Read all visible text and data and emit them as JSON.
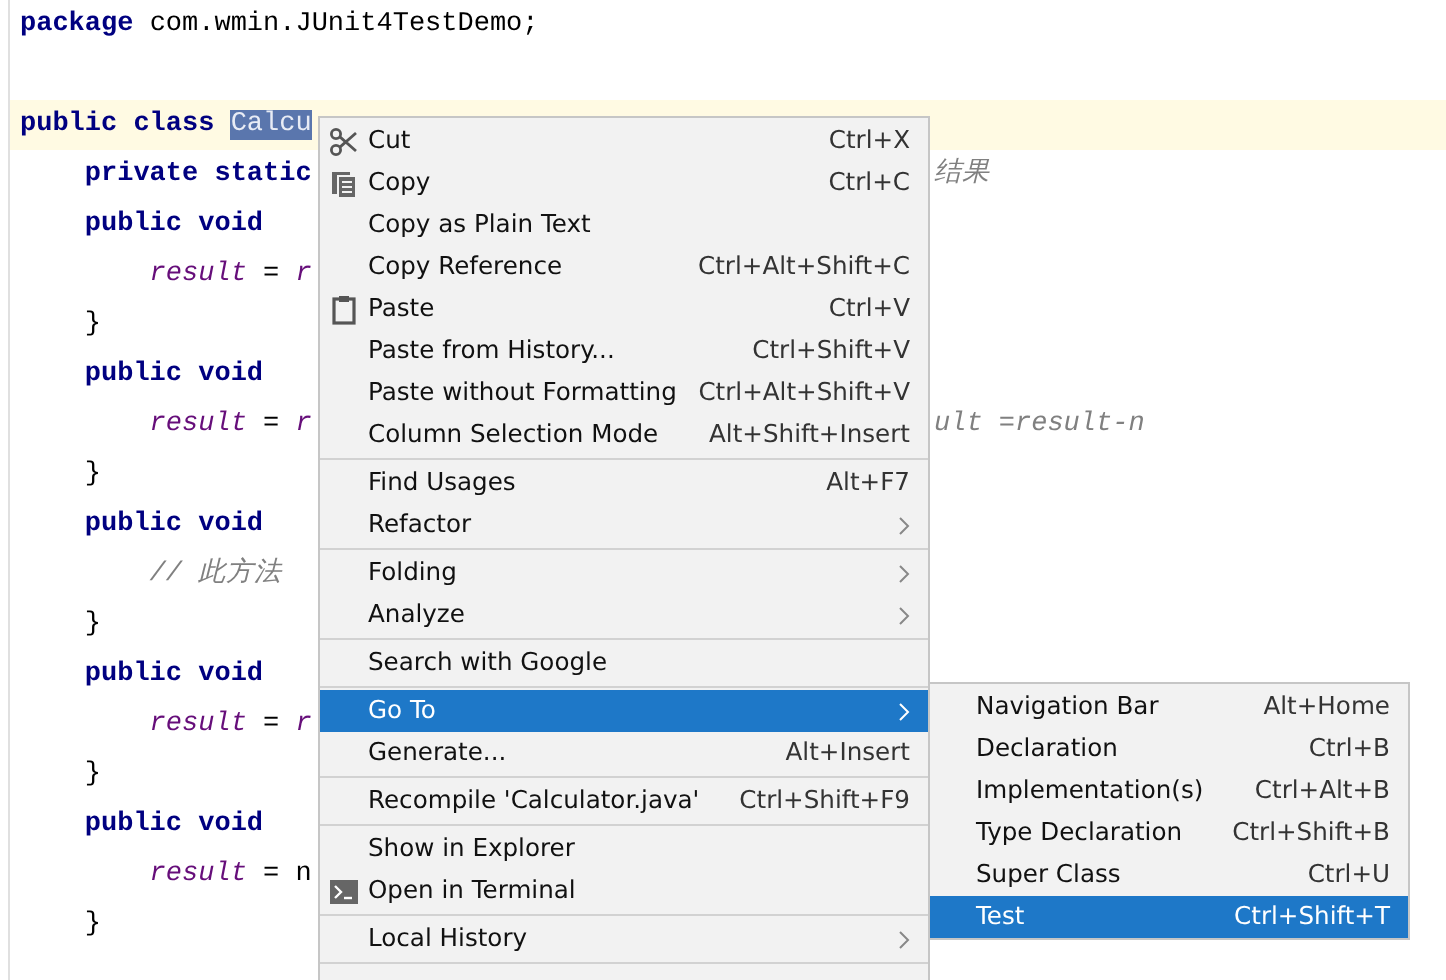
{
  "editor": {
    "header": [
      {
        "text": "package",
        "kind": "keyword"
      },
      {
        "text": " com.wmin.JUnit4TestDemo;",
        "kind": "plain"
      }
    ],
    "lines": [
      {
        "current": true,
        "segments": [
          {
            "text": "public class ",
            "kind": "keyword"
          },
          {
            "text": "Calcu",
            "kind": "selected"
          }
        ]
      },
      {
        "current": false,
        "segments": [
          {
            "text": "    private static",
            "kind": "keyword"
          }
        ],
        "tail": {
          "text": "结果",
          "kind": "comment"
        }
      },
      {
        "current": false,
        "segments": [
          {
            "text": "    public void",
            "kind": "keyword"
          }
        ]
      },
      {
        "current": false,
        "segments": [
          {
            "text": "        result",
            "kind": "field"
          },
          {
            "text": " = ",
            "kind": "plain"
          },
          {
            "text": "r",
            "kind": "field"
          }
        ]
      },
      {
        "current": false,
        "segments": [
          {
            "text": "    }",
            "kind": "plain"
          }
        ]
      },
      {
        "current": false,
        "segments": [
          {
            "text": "    public void",
            "kind": "keyword"
          }
        ]
      },
      {
        "current": false,
        "segments": [
          {
            "text": "        result",
            "kind": "field"
          },
          {
            "text": " = ",
            "kind": "plain"
          },
          {
            "text": "r",
            "kind": "field"
          }
        ],
        "tail": {
          "text": "ult =result-n",
          "kind": "comment"
        }
      },
      {
        "current": false,
        "segments": [
          {
            "text": "    }",
            "kind": "plain"
          }
        ]
      },
      {
        "current": false,
        "segments": [
          {
            "text": "    public void",
            "kind": "keyword"
          }
        ]
      },
      {
        "current": false,
        "segments": [
          {
            "text": "        // 此方法",
            "kind": "comment"
          }
        ]
      },
      {
        "current": false,
        "segments": [
          {
            "text": "    }",
            "kind": "plain"
          }
        ]
      },
      {
        "current": false,
        "segments": [
          {
            "text": "    public void",
            "kind": "keyword"
          }
        ]
      },
      {
        "current": false,
        "segments": [
          {
            "text": "        result",
            "kind": "field"
          },
          {
            "text": " = ",
            "kind": "plain"
          },
          {
            "text": "r",
            "kind": "field"
          }
        ]
      },
      {
        "current": false,
        "segments": [
          {
            "text": "    }",
            "kind": "plain"
          }
        ]
      },
      {
        "current": false,
        "segments": [
          {
            "text": "    public void",
            "kind": "keyword"
          }
        ]
      },
      {
        "current": false,
        "segments": [
          {
            "text": "        result",
            "kind": "field"
          },
          {
            "text": " = n",
            "kind": "plain"
          }
        ]
      },
      {
        "current": false,
        "segments": [
          {
            "text": "    }",
            "kind": "plain"
          }
        ]
      }
    ]
  },
  "context_menu": {
    "groups": [
      [
        {
          "label": "Cut",
          "shortcut": "Ctrl+X",
          "submenu": false,
          "selected": false
        },
        {
          "label": "Copy",
          "shortcut": "Ctrl+C",
          "submenu": false,
          "selected": false
        },
        {
          "label": "Copy as Plain Text",
          "submenu": false,
          "selected": false
        },
        {
          "label": "Copy Reference",
          "shortcut": "Ctrl+Alt+Shift+C",
          "submenu": false,
          "selected": false
        },
        {
          "label": "Paste",
          "shortcut": "Ctrl+V",
          "submenu": false,
          "selected": false
        },
        {
          "label": "Paste from History...",
          "shortcut": "Ctrl+Shift+V",
          "submenu": false,
          "selected": false
        },
        {
          "label": "Paste without Formatting",
          "shortcut": "Ctrl+Alt+Shift+V",
          "submenu": false,
          "selected": false
        },
        {
          "label": "Column Selection Mode",
          "shortcut": "Alt+Shift+Insert",
          "submenu": false,
          "selected": false
        }
      ],
      [
        {
          "label": "Find Usages",
          "shortcut": "Alt+F7",
          "submenu": false,
          "selected": false
        },
        {
          "label": "Refactor",
          "submenu": true,
          "selected": false
        }
      ],
      [
        {
          "label": "Folding",
          "submenu": true,
          "selected": false
        },
        {
          "label": "Analyze",
          "submenu": true,
          "selected": false
        }
      ],
      [
        {
          "label": "Search with Google",
          "submenu": false,
          "selected": false
        }
      ],
      [
        {
          "label": "Go To",
          "submenu": true,
          "selected": true
        },
        {
          "label": "Generate...",
          "shortcut": "Alt+Insert",
          "submenu": false,
          "selected": false
        }
      ],
      [
        {
          "label": "Recompile 'Calculator.java'",
          "shortcut": "Ctrl+Shift+F9",
          "submenu": false,
          "selected": false
        }
      ],
      [
        {
          "label": "Show in Explorer",
          "submenu": false,
          "selected": false
        },
        {
          "label": "Open in Terminal",
          "submenu": false,
          "selected": false
        }
      ],
      [
        {
          "label": "Local History",
          "submenu": true,
          "selected": false
        }
      ]
    ]
  },
  "submenu": {
    "items": [
      {
        "label": "Navigation Bar",
        "shortcut": "Alt+Home",
        "selected": false
      },
      {
        "label": "Declaration",
        "shortcut": "Ctrl+B",
        "selected": false
      },
      {
        "label": "Implementation(s)",
        "shortcut": "Ctrl+Alt+B",
        "selected": false
      },
      {
        "label": "Type Declaration",
        "shortcut": "Ctrl+Shift+B",
        "selected": false
      },
      {
        "label": "Super Class",
        "shortcut": "Ctrl+U",
        "selected": false
      },
      {
        "label": "Test",
        "shortcut": "Ctrl+Shift+T",
        "selected": true
      }
    ]
  }
}
